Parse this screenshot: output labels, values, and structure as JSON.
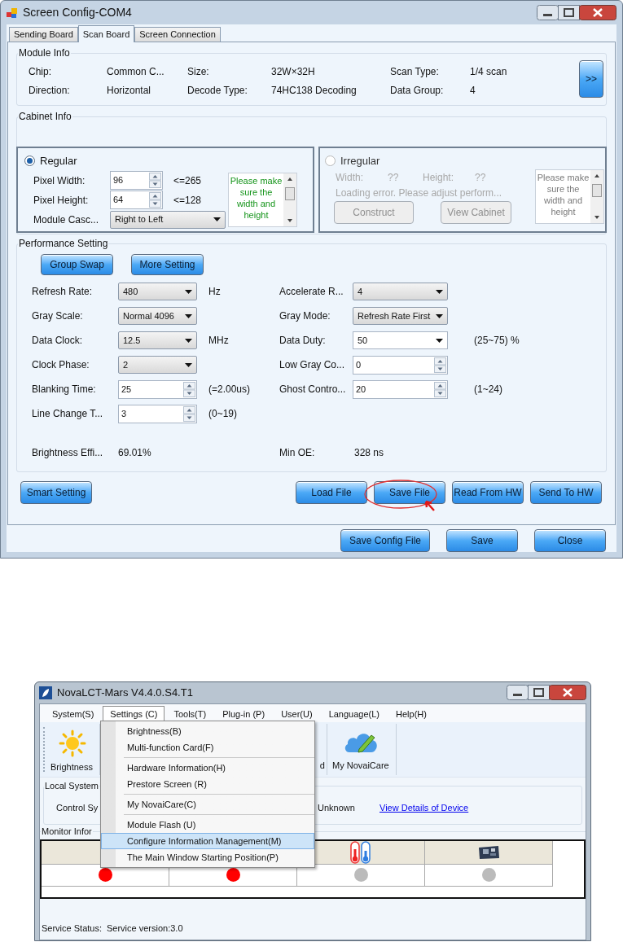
{
  "config_window": {
    "title": "Screen Config-COM4",
    "tabs": [
      {
        "label": "Sending Board",
        "selected": false
      },
      {
        "label": "Scan Board",
        "selected": true
      },
      {
        "label": "Screen Connection",
        "selected": false
      }
    ],
    "module_info": {
      "title": "Module Info",
      "fields": [
        {
          "label": "Chip:",
          "value": "Common C..."
        },
        {
          "label": "Size:",
          "value": "32W×32H"
        },
        {
          "label": "Scan Type:",
          "value": "1/4 scan"
        },
        {
          "label": "Direction:",
          "value": "Horizontal"
        },
        {
          "label": "Decode Type:",
          "value": "74HC138 Decoding"
        },
        {
          "label": "Data Group:",
          "value": "4"
        }
      ],
      "expand_button": ">>"
    },
    "cabinet_info": {
      "title": "Cabinet Info",
      "regular": {
        "label": "Regular",
        "selected": true,
        "disabled": false,
        "fields": [
          {
            "label": "Pixel Width:",
            "kind": "spin",
            "value": "96",
            "hint": "<=265"
          },
          {
            "label": "Pixel Height:",
            "kind": "spin",
            "value": "64",
            "hint": "<=128"
          },
          {
            "label": "Module Casc...",
            "kind": "dropdown",
            "value": "Right to Left"
          }
        ],
        "note": "Please make sure the width and height"
      },
      "irregular": {
        "label": "Irregular",
        "selected": false,
        "disabled": true,
        "fields": [
          {
            "label": "Width:",
            "value": "??"
          },
          {
            "label": "Height:",
            "value": "??"
          }
        ],
        "message": "Loading error. Please adjust perform...",
        "buttons": [
          "Construct",
          "View Cabinet"
        ],
        "note": "Please make sure the width and height"
      }
    },
    "performance": {
      "title": "Performance Setting",
      "top_buttons": [
        "Group Swap",
        "More Setting"
      ],
      "left": [
        {
          "label": "Refresh Rate:",
          "kind": "dropdown",
          "value": "480",
          "unit": "Hz"
        },
        {
          "label": "Gray Scale:",
          "kind": "dropdown",
          "value": "Normal 4096"
        },
        {
          "label": "Data Clock:",
          "kind": "dropdown",
          "value": "12.5",
          "unit": "MHz"
        },
        {
          "label": "Clock Phase:",
          "kind": "dropdown",
          "value": "2"
        },
        {
          "label": "Blanking Time:",
          "kind": "spin",
          "value": "25",
          "unit": "(=2.00us)"
        },
        {
          "label": "Line Change T...",
          "kind": "spin",
          "value": "3",
          "unit": "(0~19)"
        }
      ],
      "right": [
        {
          "label": "Accelerate R...",
          "kind": "dropdown",
          "value": "4"
        },
        {
          "label": "Gray Mode:",
          "kind": "dropdown",
          "value": "Refresh Rate First"
        },
        {
          "label": "Data Duty:",
          "kind": "combo",
          "value": "50",
          "unit": "(25~75) %"
        },
        {
          "label": "Low Gray Co...",
          "kind": "spin",
          "value": "0"
        },
        {
          "label": "Ghost Contro...",
          "kind": "spin",
          "value": "20",
          "unit": "(1~24)"
        }
      ],
      "readouts": [
        {
          "label": "Brightness Effi...",
          "value": "69.01%"
        },
        {
          "label": "Min OE:",
          "value": "328 ns"
        }
      ]
    },
    "action_buttons": [
      {
        "label": "Smart Setting",
        "circled": false
      },
      {
        "label": "Load File",
        "circled": false
      },
      {
        "label": "Save File",
        "circled": true
      },
      {
        "label": "Read From HW",
        "circled": false
      },
      {
        "label": "Send To HW",
        "circled": false
      }
    ],
    "dialog_buttons": [
      "Save Config File",
      "Save",
      "Close"
    ]
  },
  "main_window": {
    "title": "NovaLCT-Mars V4.4.0.S4.T1",
    "menu_bar": [
      {
        "label": "System(S)",
        "selected": false
      },
      {
        "label": "Settings (C)",
        "selected": true
      },
      {
        "label": "Tools(T)",
        "selected": false
      },
      {
        "label": "Plug-in (P)",
        "selected": false
      },
      {
        "label": "User(U)",
        "selected": false
      },
      {
        "label": "Language(L)",
        "selected": false
      },
      {
        "label": "Help(H)",
        "selected": false
      }
    ],
    "toolbar": [
      {
        "label": "Brightness",
        "kind": "sun"
      },
      {
        "label": "d",
        "kind": "covered"
      },
      {
        "label": "My NovaiCare",
        "kind": "cloud"
      }
    ],
    "local_system": {
      "title": "Local System",
      "label": "Control Sy",
      "value": "Unknown",
      "link": "View Details of Device"
    },
    "monitor": {
      "title": "Monitor Infor",
      "status": [
        {
          "color": "#ff0000"
        },
        {
          "color": "#ff0000"
        },
        {
          "color": "#bbbbbb"
        },
        {
          "color": "#bbbbbb"
        }
      ]
    },
    "status_bar": {
      "label": "Service Status:",
      "value": "Service version:3.0"
    },
    "settings_menu": {
      "groups": [
        {
          "items": [
            {
              "label": "Brightness(B)",
              "selected": false
            },
            {
              "label": "Multi-function Card(F)",
              "selected": false
            }
          ]
        },
        {
          "items": [
            {
              "label": "Hardware Information(H)",
              "selected": false
            },
            {
              "label": "Prestore Screen (R)",
              "selected": false
            }
          ]
        },
        {
          "items": [
            {
              "label": "My NovaiCare(C)",
              "selected": false
            }
          ]
        },
        {
          "items": [
            {
              "label": "Module Flash (U)",
              "selected": false
            },
            {
              "label": "Configure Information Management(M)",
              "selected": true
            },
            {
              "label": "The Main Window Starting Position(P)",
              "selected": false
            }
          ]
        }
      ]
    }
  }
}
